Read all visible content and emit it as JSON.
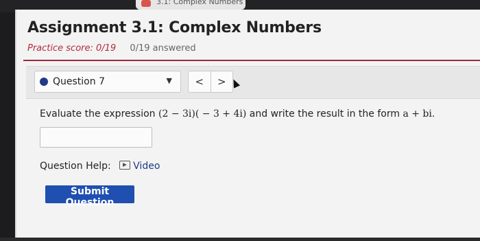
{
  "browser": {
    "tab_title": "3.1: Complex Numbers"
  },
  "header": {
    "title": "Assignment 3.1: Complex Numbers",
    "practice_score": "Practice score: 0/19",
    "answered": "0/19 answered"
  },
  "question_nav": {
    "selected_question": "Question 7",
    "prev_label": "<",
    "next_label": ">",
    "dropdown_caret": "▼"
  },
  "question": {
    "prompt_start": "Evaluate the expression ",
    "expression": "(2 − 3i)( − 3 + 4i)",
    "prompt_middle": " and write the result in the form ",
    "form": "a + bi",
    "prompt_end": ".",
    "answer_value": ""
  },
  "help": {
    "label": "Question Help:",
    "video_label": "Video"
  },
  "actions": {
    "submit_label": "Submit Question"
  },
  "colors": {
    "accent": "#9a2a38",
    "score": "#b22b3b",
    "primary_button": "#1f4fb0",
    "dot": "#1f3a88"
  }
}
